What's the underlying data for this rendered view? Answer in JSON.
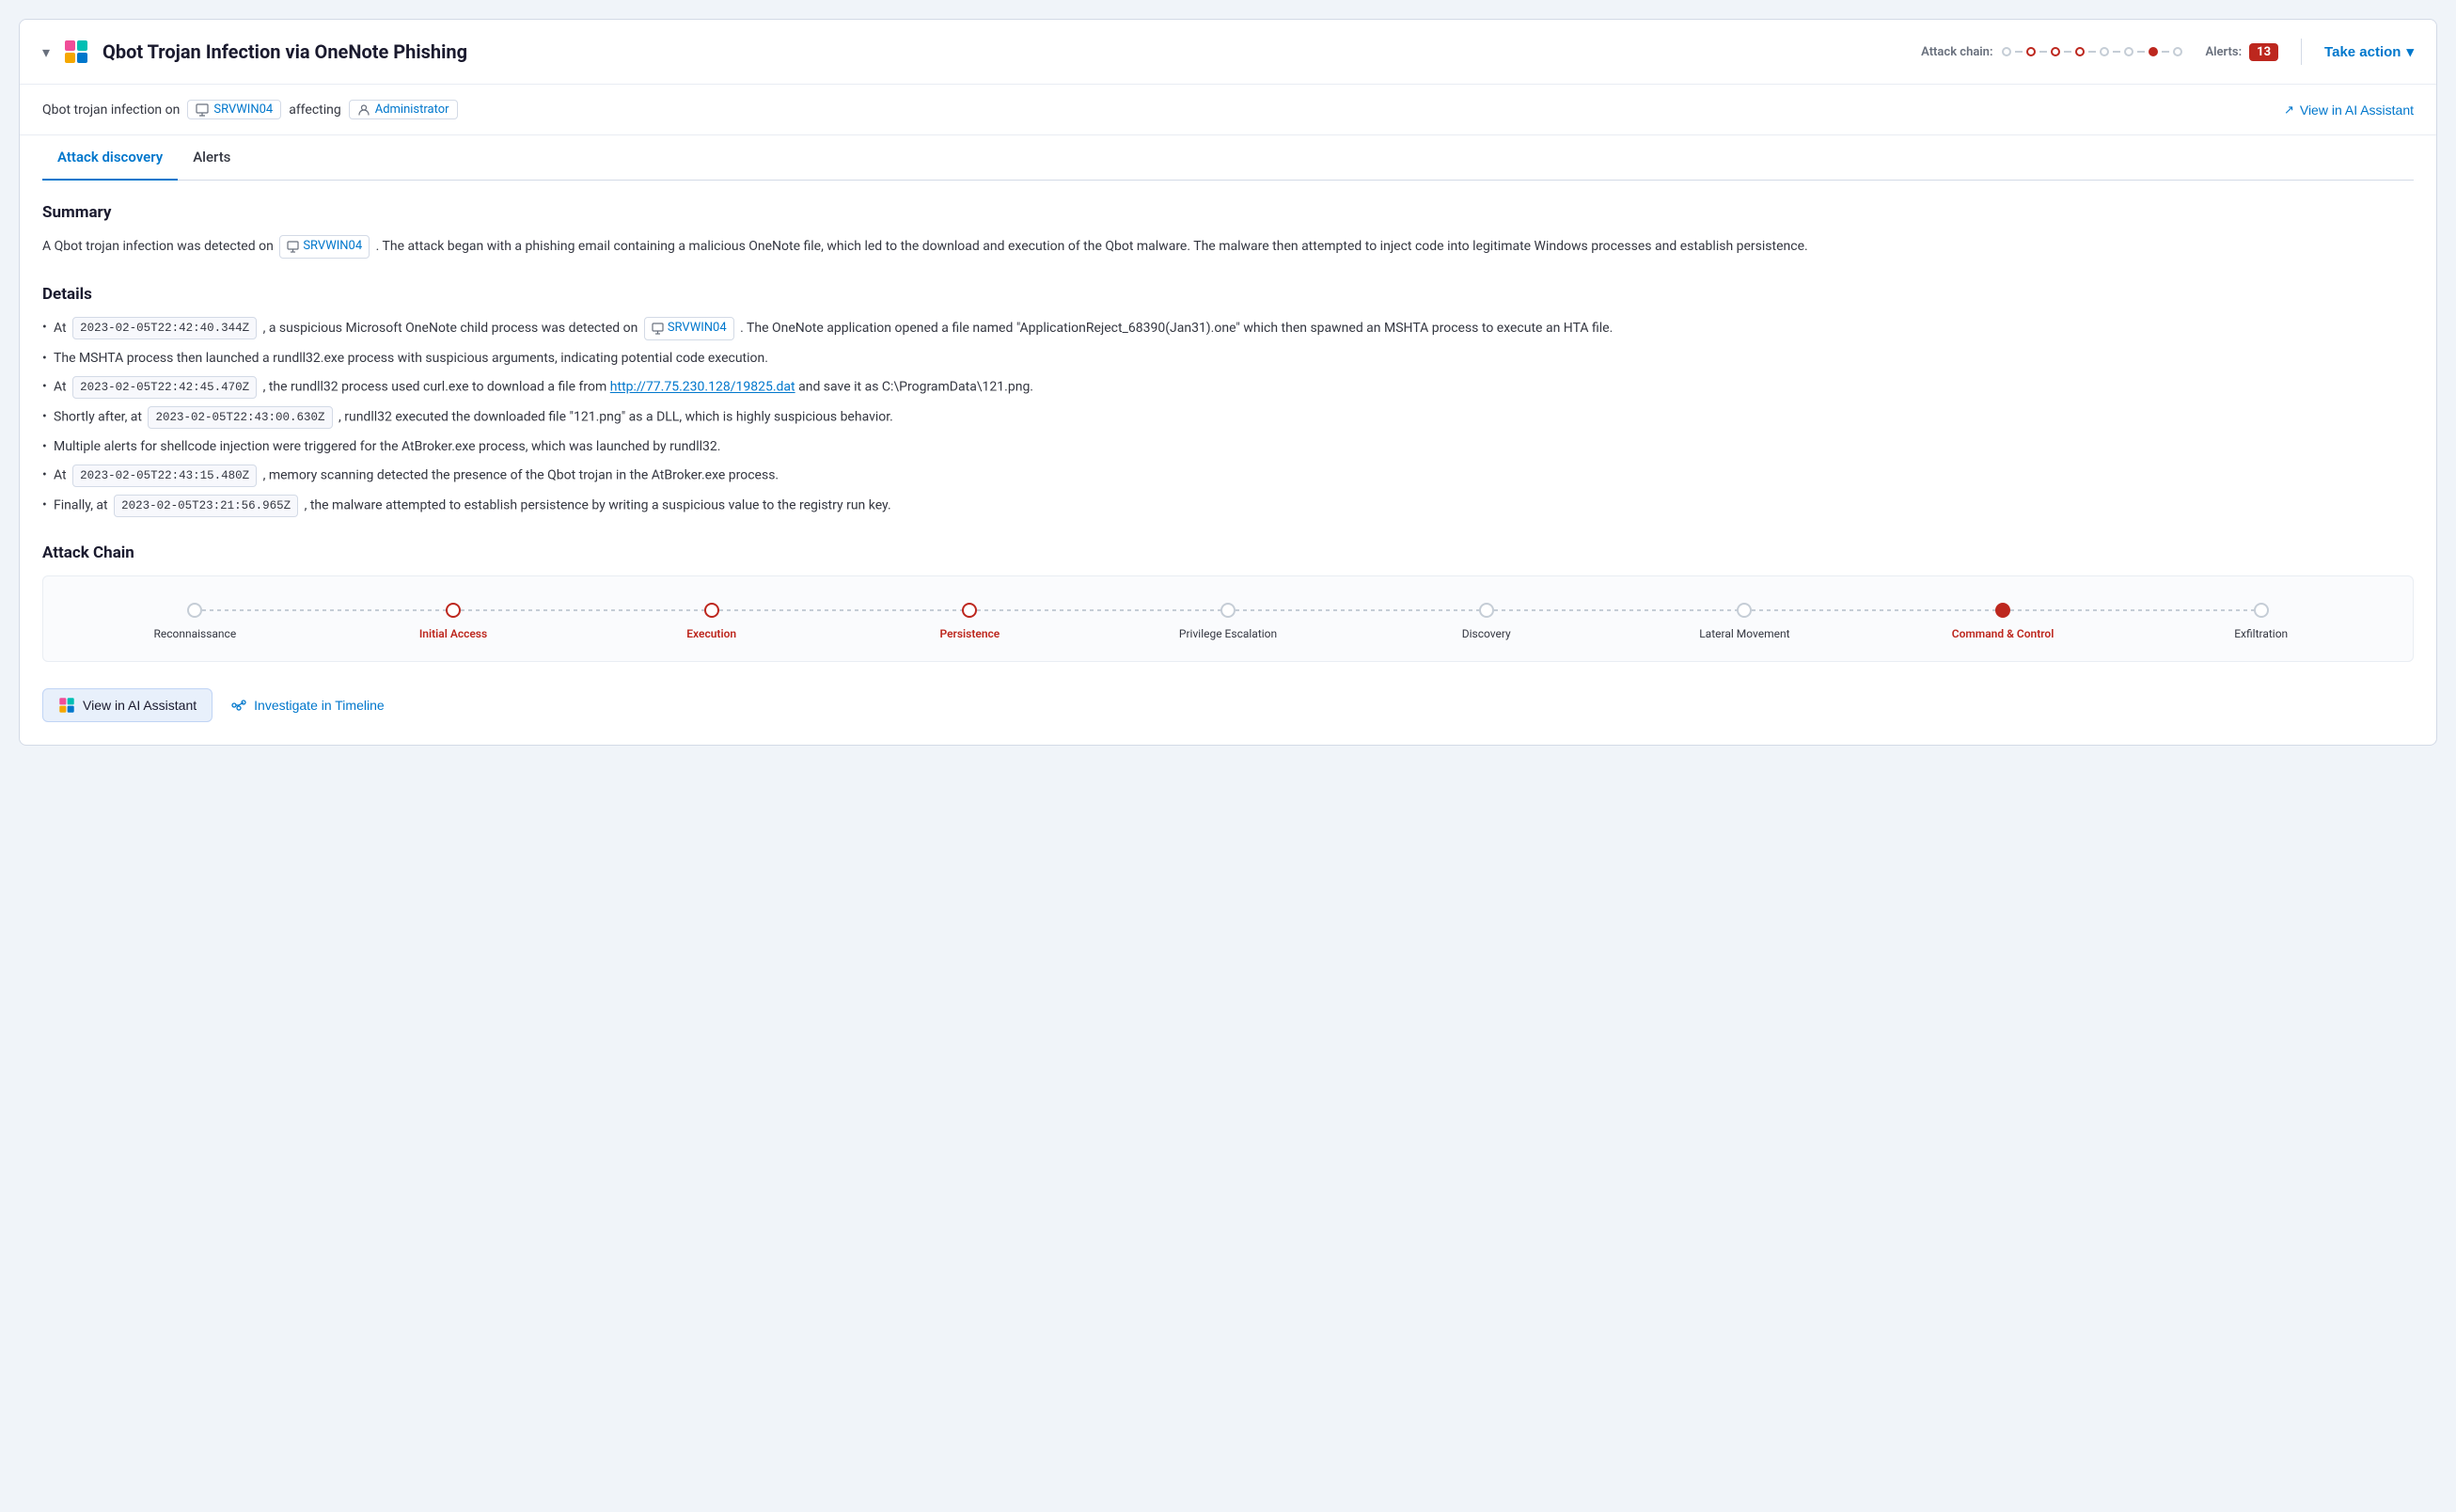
{
  "header": {
    "collapse_icon": "▾",
    "title": "Qbot Trojan Infection via OneNote Phishing",
    "attack_chain_label": "Attack chain:",
    "alerts_label": "Alerts:",
    "alerts_count": "13",
    "take_action_label": "Take action"
  },
  "subtitle": {
    "prefix": "Qbot trojan infection on",
    "host": "SRVWIN04",
    "affecting": "affecting",
    "user": "Administrator",
    "view_ai_label": "View in AI Assistant"
  },
  "tabs": [
    {
      "label": "Attack discovery",
      "active": true
    },
    {
      "label": "Alerts",
      "active": false
    }
  ],
  "summary": {
    "title": "Summary",
    "host_tag": "SRVWIN04",
    "text_before": "A Qbot trojan infection was detected on",
    "text_after": ". The attack began with a phishing email containing a malicious OneNote file, which led to the download and execution of the Qbot malware. The malware then attempted to inject code into legitimate Windows processes and establish persistence."
  },
  "details": {
    "title": "Details",
    "items": [
      {
        "text_before": "At",
        "timestamp": "2023-02-05T22:42:40.344Z",
        "text_middle": ", a suspicious Microsoft OneNote child process was detected on",
        "host_tag": "SRVWIN04",
        "text_after": ". The OneNote application opened a file named \"ApplicationReject_68390(Jan31).one\" which then spawned an MSHTA process to execute an HTA file."
      },
      {
        "text": "The MSHTA process then launched a rundll32.exe process with suspicious arguments, indicating potential code execution."
      },
      {
        "text_before": "At",
        "timestamp": "2023-02-05T22:42:45.470Z",
        "text_after_link": ", the rundll32 process used curl.exe to download a file from",
        "link_url": "http://77.75.230.128/19825.dat",
        "text_end": "and save it as C:\\ProgramData\\121.png."
      },
      {
        "text_before": "Shortly after, at",
        "timestamp": "2023-02-05T22:43:00.630Z",
        "text_after": ", rundll32 executed the downloaded file \"121.png\" as a DLL, which is highly suspicious behavior."
      },
      {
        "text": "Multiple alerts for shellcode injection were triggered for the AtBroker.exe process, which was launched by rundll32."
      },
      {
        "text_before": "At",
        "timestamp": "2023-02-05T22:43:15.480Z",
        "text_after": ", memory scanning detected the presence of the Qbot trojan in the AtBroker.exe process."
      },
      {
        "text_before": "Finally, at",
        "timestamp": "2023-02-05T23:21:56.965Z",
        "text_after": ", the malware attempted to establish persistence by writing a suspicious value to the registry run key."
      }
    ]
  },
  "attack_chain": {
    "title": "Attack Chain",
    "stages": [
      {
        "label": "Reconnaissance",
        "active": false,
        "filled": false
      },
      {
        "label": "Initial Access",
        "active": true,
        "filled": false
      },
      {
        "label": "Execution",
        "active": true,
        "filled": false
      },
      {
        "label": "Persistence",
        "active": true,
        "filled": false
      },
      {
        "label": "Privilege Escalation",
        "active": false,
        "filled": false
      },
      {
        "label": "Discovery",
        "active": false,
        "filled": false
      },
      {
        "label": "Lateral Movement",
        "active": false,
        "filled": false
      },
      {
        "label": "Command & Control",
        "active": true,
        "filled": true
      },
      {
        "label": "Exfiltration",
        "active": false,
        "filled": false
      }
    ]
  },
  "bottom_actions": {
    "view_ai_label": "View in AI Assistant",
    "investigate_label": "Investigate in Timeline"
  }
}
